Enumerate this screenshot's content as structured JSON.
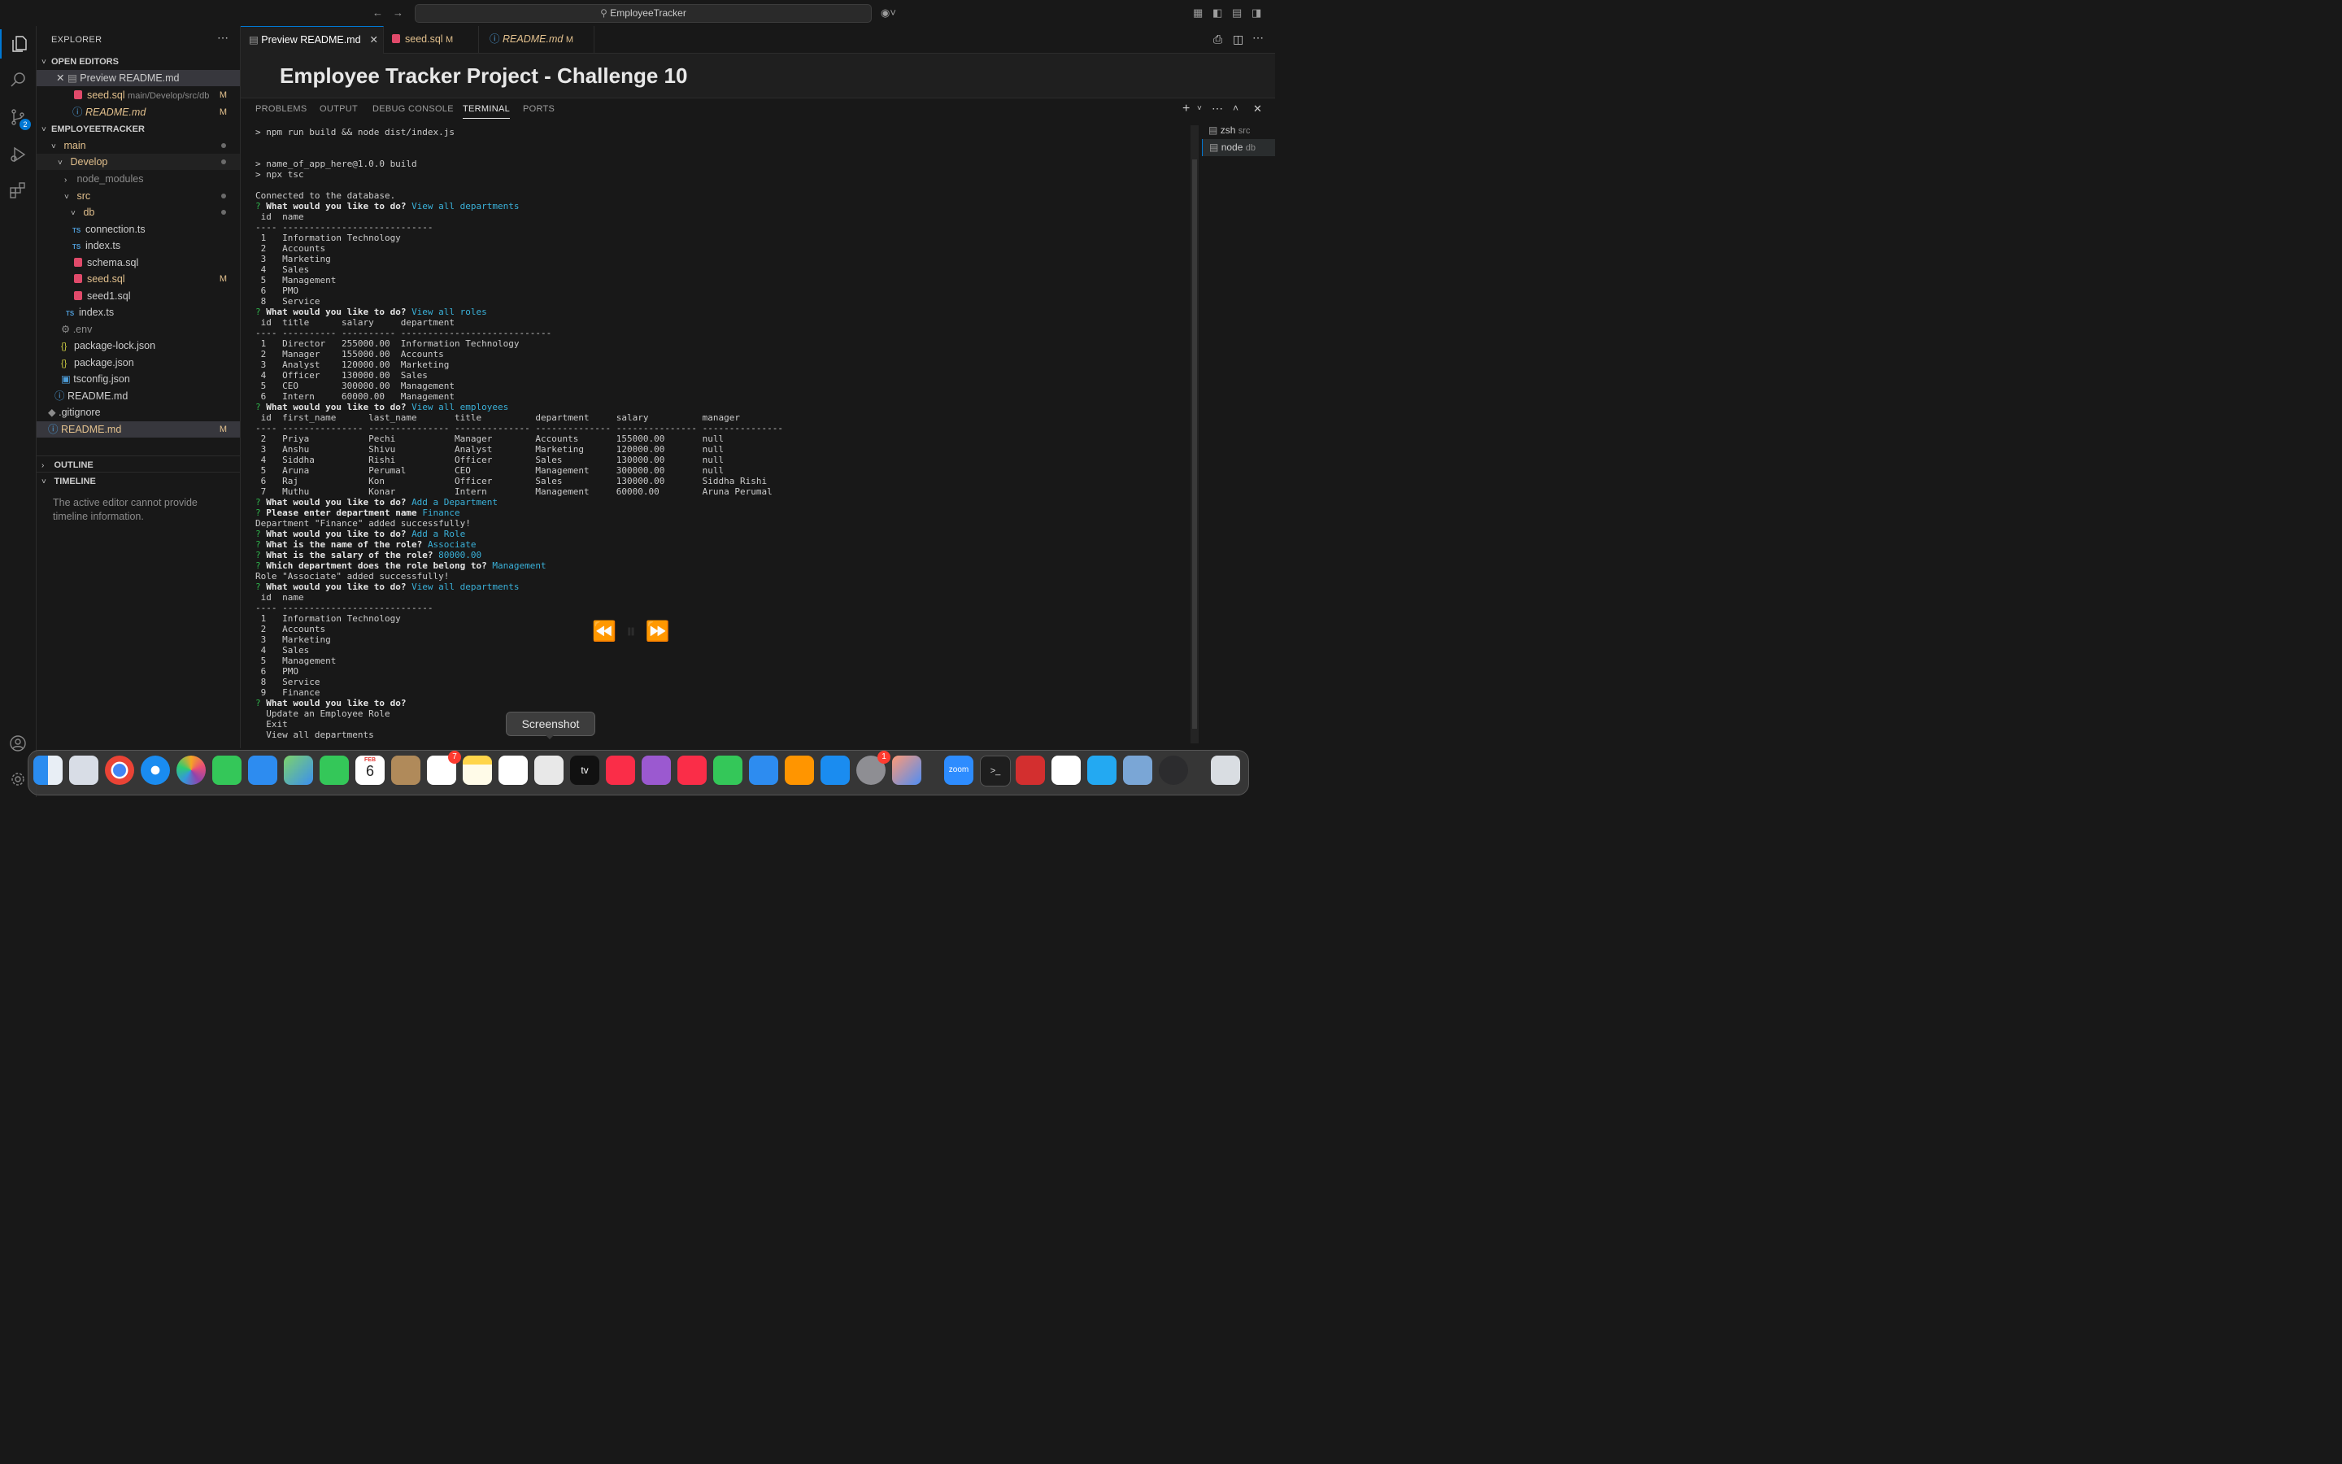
{
  "titlebar": {
    "search": "EmployeeTracker"
  },
  "activity": {
    "scm_badge": "2"
  },
  "sidebar": {
    "title": "EXPLORER",
    "open_editors": "OPEN EDITORS",
    "open_items": [
      {
        "label": "Preview README.md",
        "desc": "",
        "mark": ""
      },
      {
        "label": "seed.sql",
        "desc": "main/Develop/src/db",
        "mark": "M"
      },
      {
        "label": "README.md",
        "desc": "",
        "mark": "M"
      }
    ],
    "workspace": "EMPLOYEETRACKER",
    "tree": [
      {
        "label": "main"
      },
      {
        "label": "Develop"
      },
      {
        "label": "node_modules"
      },
      {
        "label": "src"
      },
      {
        "label": "db"
      },
      {
        "label": "connection.ts"
      },
      {
        "label": "index.ts"
      },
      {
        "label": "schema.sql"
      },
      {
        "label": "seed.sql",
        "mark": "M"
      },
      {
        "label": "seed1.sql"
      },
      {
        "label": "index.ts"
      },
      {
        "label": ".env"
      },
      {
        "label": "package-lock.json"
      },
      {
        "label": "package.json"
      },
      {
        "label": "tsconfig.json"
      },
      {
        "label": "README.md"
      },
      {
        "label": ".gitignore"
      },
      {
        "label": "README.md",
        "mark": "M"
      }
    ],
    "outline": "OUTLINE",
    "timeline": "TIMELINE",
    "timeline_msg_1": "The active editor cannot provide",
    "timeline_msg_2": "timeline information."
  },
  "tabs": [
    {
      "label": "Preview README.md",
      "mark": ""
    },
    {
      "label": "seed.sql",
      "mark": "M"
    },
    {
      "label": "README.md",
      "mark": "M"
    }
  ],
  "editor": {
    "heading": "Employee Tracker Project - Challenge 10"
  },
  "panel": {
    "tabs": [
      "PROBLEMS",
      "OUTPUT",
      "DEBUG CONSOLE",
      "TERMINAL",
      "PORTS"
    ],
    "terminals": [
      {
        "name": "zsh",
        "cwd": "src"
      },
      {
        "name": "node",
        "cwd": "db"
      }
    ]
  },
  "terminal_lines": [
    [
      [
        "p",
        "> npm run build && node dist/index.js"
      ]
    ],
    [
      [
        "p",
        ""
      ]
    ],
    [
      [
        "p",
        ""
      ]
    ],
    [
      [
        "p",
        "> name_of_app_here@1.0.0 build"
      ]
    ],
    [
      [
        "p",
        "> npx tsc"
      ]
    ],
    [
      [
        "p",
        ""
      ]
    ],
    [
      [
        "p",
        "Connected to the database."
      ]
    ],
    [
      [
        "q",
        "? "
      ],
      [
        "b",
        "What would you like to do? "
      ],
      [
        "c",
        "View all departments"
      ]
    ],
    [
      [
        "p",
        " id  name"
      ]
    ],
    [
      [
        "p",
        "---- ----------------------------"
      ]
    ],
    [
      [
        "p",
        " 1   Information Technology"
      ]
    ],
    [
      [
        "p",
        " 2   Accounts"
      ]
    ],
    [
      [
        "p",
        " 3   Marketing"
      ]
    ],
    [
      [
        "p",
        " 4   Sales"
      ]
    ],
    [
      [
        "p",
        " 5   Management"
      ]
    ],
    [
      [
        "p",
        " 6   PMO"
      ]
    ],
    [
      [
        "p",
        " 8   Service"
      ]
    ],
    [
      [
        "q",
        "? "
      ],
      [
        "b",
        "What would you like to do? "
      ],
      [
        "c",
        "View all roles"
      ]
    ],
    [
      [
        "p",
        " id  title      salary     department"
      ]
    ],
    [
      [
        "p",
        "---- ---------- ---------- ----------------------------"
      ]
    ],
    [
      [
        "p",
        " 1   Director   255000.00  Information Technology"
      ]
    ],
    [
      [
        "p",
        " 2   Manager    155000.00  Accounts"
      ]
    ],
    [
      [
        "p",
        " 3   Analyst    120000.00  Marketing"
      ]
    ],
    [
      [
        "p",
        " 4   Officer    130000.00  Sales"
      ]
    ],
    [
      [
        "p",
        " 5   CEO        300000.00  Management"
      ]
    ],
    [
      [
        "p",
        " 6   Intern     60000.00   Management"
      ]
    ],
    [
      [
        "q",
        "? "
      ],
      [
        "b",
        "What would you like to do? "
      ],
      [
        "c",
        "View all employees"
      ]
    ],
    [
      [
        "p",
        " id  first_name      last_name       title          department     salary          manager"
      ]
    ],
    [
      [
        "p",
        "---- --------------- --------------- -------------- -------------- --------------- ---------------"
      ]
    ],
    [
      [
        "p",
        " 2   Priya           Pechi           Manager        Accounts       155000.00       null"
      ]
    ],
    [
      [
        "p",
        " 3   Anshu           Shivu           Analyst        Marketing      120000.00       null"
      ]
    ],
    [
      [
        "p",
        " 4   Siddha          Rishi           Officer        Sales          130000.00       null"
      ]
    ],
    [
      [
        "p",
        " 5   Aruna           Perumal         CEO            Management     300000.00       null"
      ]
    ],
    [
      [
        "p",
        " 6   Raj             Kon             Officer        Sales          130000.00       Siddha Rishi"
      ]
    ],
    [
      [
        "p",
        " 7   Muthu           Konar           Intern         Management     60000.00        Aruna Perumal"
      ]
    ],
    [
      [
        "q",
        "? "
      ],
      [
        "b",
        "What would you like to do? "
      ],
      [
        "c",
        "Add a Department"
      ]
    ],
    [
      [
        "q",
        "? "
      ],
      [
        "b",
        "Please enter department name "
      ],
      [
        "c",
        "Finance"
      ]
    ],
    [
      [
        "p",
        "Department \"Finance\" added successfully!"
      ]
    ],
    [
      [
        "q",
        "? "
      ],
      [
        "b",
        "What would you like to do? "
      ],
      [
        "c",
        "Add a Role"
      ]
    ],
    [
      [
        "q",
        "? "
      ],
      [
        "b",
        "What is the name of the role? "
      ],
      [
        "c",
        "Associate"
      ]
    ],
    [
      [
        "q",
        "? "
      ],
      [
        "b",
        "What is the salary of the role? "
      ],
      [
        "c",
        "80000.00"
      ]
    ],
    [
      [
        "q",
        "? "
      ],
      [
        "b",
        "Which department does the role belong to? "
      ],
      [
        "c",
        "Management"
      ]
    ],
    [
      [
        "p",
        "Role \"Associate\" added successfully!"
      ]
    ],
    [
      [
        "q",
        "? "
      ],
      [
        "b",
        "What would you like to do? "
      ],
      [
        "c",
        "View all departments"
      ]
    ],
    [
      [
        "p",
        " id  name"
      ]
    ],
    [
      [
        "p",
        "---- ----------------------------"
      ]
    ],
    [
      [
        "p",
        " 1   Information Technology"
      ]
    ],
    [
      [
        "p",
        " 2   Accounts"
      ]
    ],
    [
      [
        "p",
        " 3   Marketing"
      ]
    ],
    [
      [
        "p",
        " 4   Sales"
      ]
    ],
    [
      [
        "p",
        " 5   Management"
      ]
    ],
    [
      [
        "p",
        " 6   PMO"
      ]
    ],
    [
      [
        "p",
        " 8   Service"
      ]
    ],
    [
      [
        "p",
        " 9   Finance"
      ]
    ],
    [
      [
        "q",
        "? "
      ],
      [
        "b",
        "What would you like to do? "
      ]
    ],
    [
      [
        "p",
        "  Update an Employee Role"
      ]
    ],
    [
      [
        "p",
        "  Exit"
      ]
    ],
    [
      [
        "p",
        "  View all departments"
      ]
    ]
  ],
  "dock": {
    "tooltip": "Screenshot",
    "calendar_month": "FEB",
    "calendar_day": "6",
    "reminders_badge": "7",
    "settings_badge": "1",
    "zoom_label": "zoom",
    "apps": [
      "finder",
      "launchpad",
      "chrome",
      "safari",
      "photos",
      "messages",
      "mail",
      "maps",
      "facetime",
      "calendar",
      "contacts",
      "reminders",
      "notes",
      "freeform",
      "screenshot",
      "apple-tv",
      "music",
      "podcasts",
      "news",
      "numbers",
      "keynote",
      "pages",
      "app-store",
      "system-settings",
      "iphone-mirroring",
      "zoom",
      "terminal",
      "acrobat",
      "slack",
      "vscode",
      "preview",
      "quicktime",
      "trash"
    ]
  }
}
